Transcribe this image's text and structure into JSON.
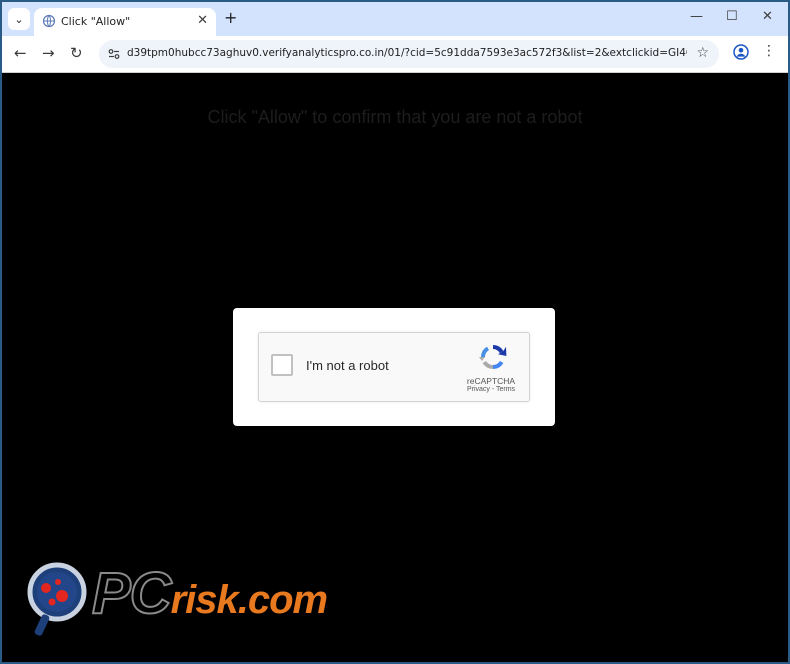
{
  "browser": {
    "tab_title": "Click \"Allow\"",
    "tab_close": "✕",
    "new_tab": "+",
    "minimize": "—",
    "maximize": "☐",
    "close": "✕",
    "back": "←",
    "forward": "→",
    "reload": "↻",
    "url": "d39tpm0hubcc73aghuv0.verifyanalyticspro.co.in/01/?cid=5c91dda7593e3ac572f3&list=2&extclickid=GI4COJxWa...",
    "bookmark": "☆",
    "menu": "⋮"
  },
  "page": {
    "headline": "Click \"Allow\" to confirm that you are not a robot"
  },
  "captcha": {
    "label": "I'm not a robot",
    "brand": "reCAPTCHA",
    "links": "Privacy - Terms",
    "checked": false
  },
  "watermark": {
    "pc": "PC",
    "risk": "risk.com"
  },
  "colors": {
    "tabstrip": "#d3e3fd",
    "page_bg": "#000000",
    "watermark_orange": "#e8791f"
  }
}
